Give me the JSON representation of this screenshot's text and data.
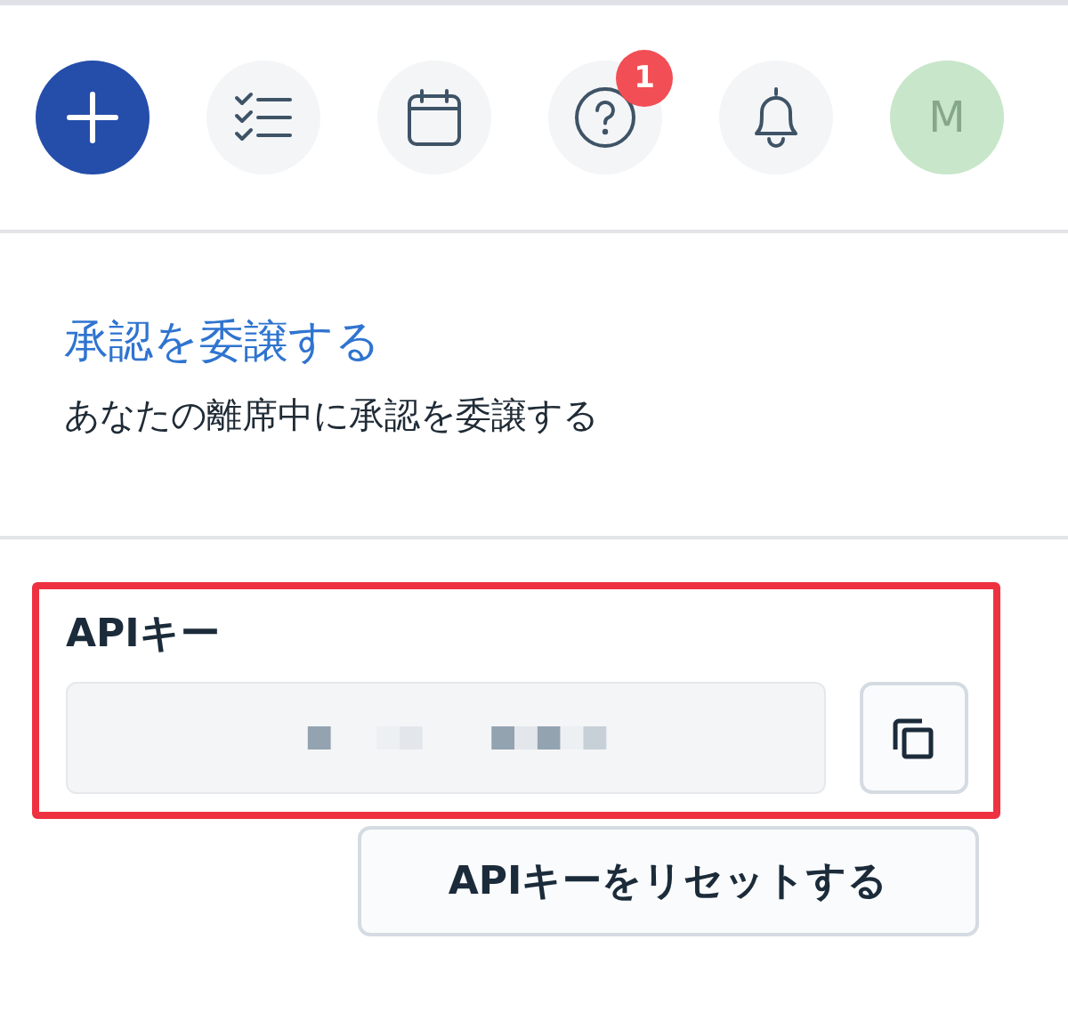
{
  "toolbar": [
    {
      "kind": "add"
    },
    {
      "kind": "tasks"
    },
    {
      "kind": "calendar"
    },
    {
      "kind": "help",
      "badge": "1"
    },
    {
      "kind": "notifications"
    },
    {
      "kind": "avatar",
      "initial": "M"
    }
  ],
  "delegation": {
    "link": "承認を委譲する",
    "description": "あなたの離席中に承認を委譲する"
  },
  "api_key": {
    "label": "APIキー",
    "highlighted": true,
    "reset_button": "APIキーをリセットする"
  }
}
